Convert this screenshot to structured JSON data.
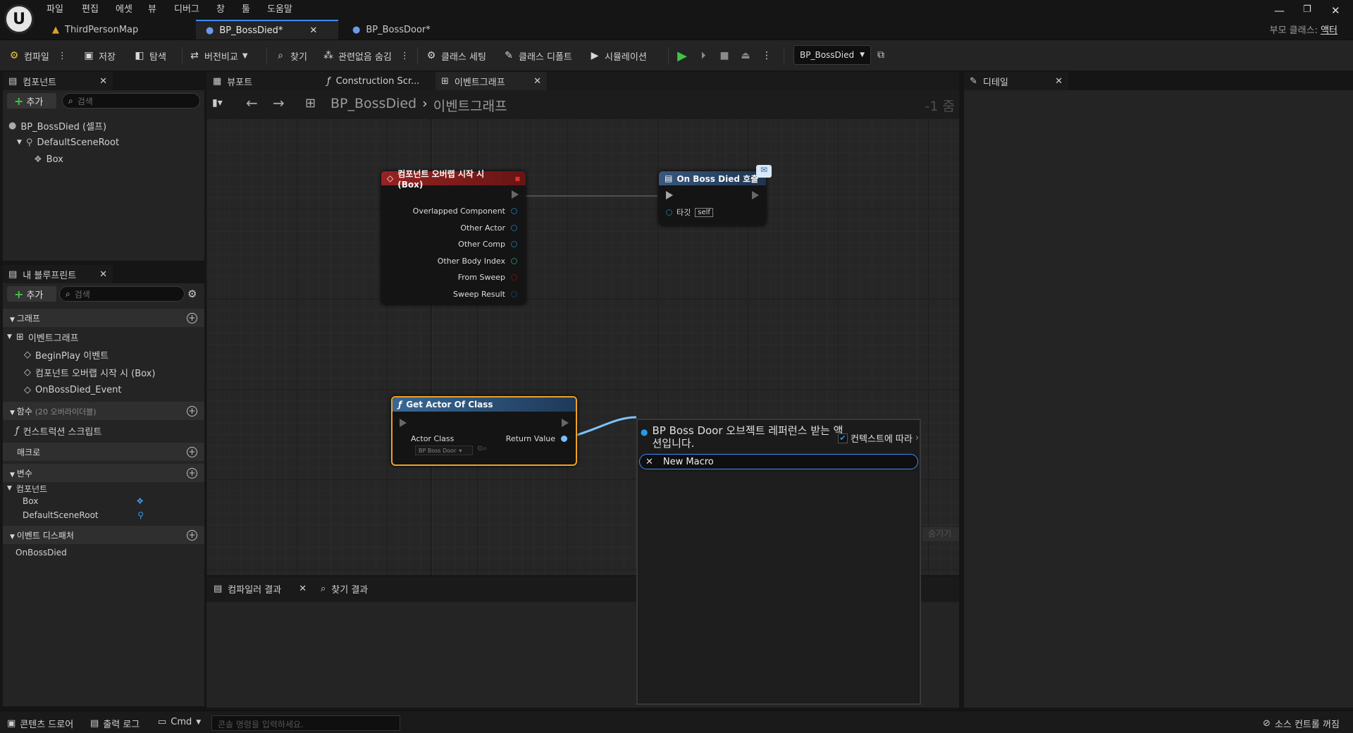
{
  "menu": [
    "파일",
    "편집",
    "에셋",
    "뷰",
    "디버그",
    "창",
    "툴",
    "도움말"
  ],
  "tabs": [
    {
      "label": "ThirdPersonMap"
    },
    {
      "label": "BP_BossDied*"
    },
    {
      "label": "BP_BossDoor*"
    }
  ],
  "parent_class": {
    "label": "부모 클래스:",
    "value": "액터"
  },
  "toolbar": {
    "compile": "컴파일",
    "save": "저장",
    "browse": "탐색",
    "diff": "버전비교",
    "find": "찾기",
    "hide_unrelated": "관련없음 숨김",
    "class_settings": "클래스 세팅",
    "class_defaults": "클래스 디폴트",
    "simulation": "시뮬레이션",
    "debug_object": "BP_BossDied"
  },
  "components_panel": {
    "title": "컴포넌트",
    "add": "추가",
    "search_placeholder": "검색",
    "items": [
      "BP_BossDied (셀프)",
      "DefaultSceneRoot",
      "Box"
    ]
  },
  "mybp_panel": {
    "title": "내 블루프린트",
    "add": "추가",
    "search_placeholder": "검색",
    "graph_cat": "그래프",
    "event_graph": "이벤트그래프",
    "events": [
      "BeginPlay 이벤트",
      "컴포넌트 오버랩 시작 시 (Box)",
      "OnBossDied_Event"
    ],
    "functions_cat": "함수",
    "functions_note": "(20 오버라이더블)",
    "construction_script": "컨스트럭션 스크립트",
    "macros_cat": "매크로",
    "variables_cat": "변수",
    "components_sub": "컴포넌트",
    "var_items": [
      "Box",
      "DefaultSceneRoot"
    ],
    "dispatchers_cat": "이벤트 디스패처",
    "dispatcher_items": [
      "OnBossDied"
    ]
  },
  "graph_tabs": [
    "뷰포트",
    "Construction Scr...",
    "이벤트그래프"
  ],
  "breadcrumb": {
    "bp": "BP_BossDied",
    "graph": "이벤트그래프",
    "zoom": "-1 줌"
  },
  "node_overlap": {
    "title": "컴포넌트 오버랩 시작 시 (Box)",
    "pins": [
      "Overlapped Component",
      "Other Actor",
      "Other Comp",
      "Other Body Index",
      "From Sweep",
      "Sweep Result"
    ]
  },
  "node_call": {
    "title": "On Boss Died 호출",
    "target": "타깃",
    "self": "self"
  },
  "node_get_actor": {
    "title": "Get Actor Of Class",
    "actor_class": "Actor Class",
    "class_value": "BP Boss Door",
    "return_value": "Return Value"
  },
  "popup": {
    "title": "BP Boss Door 오브젝트 레퍼런스 받는 액션입니다.",
    "context": "컨텍스트에 따라",
    "search_value": "New Macro"
  },
  "hidden_button": "숨기기",
  "details_panel": {
    "title": "디테일"
  },
  "bottom_tabs": [
    "컴파일러 결과",
    "찾기 결과"
  ],
  "status": {
    "content_drawer": "콘텐츠 드로어",
    "output_log": "출력 로그",
    "cmd": "Cmd",
    "console_placeholder": "콘솔 명령을 입력하세요.",
    "source_control": "소스 컨트롤 꺼짐"
  },
  "colors": {
    "accent": "#3d8bff",
    "event_header": "#8b1c1c",
    "call_header": "#2a4a6e",
    "func_header": "#2b4f7a",
    "selected": "#f5a623",
    "exec_green": "#3fc33f"
  }
}
